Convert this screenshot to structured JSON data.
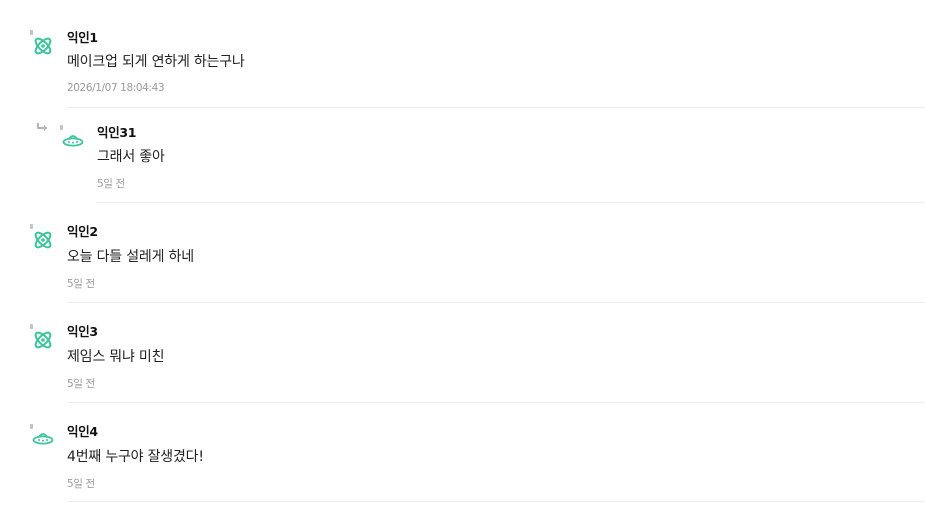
{
  "comments": [
    {
      "nickname": "익인1",
      "text": "메이크업 되게 연하게 하는구나",
      "time": "2026/1/07 18:04:43",
      "avatar_icon": "atom-icon",
      "is_reply": false
    },
    {
      "nickname": "익인31",
      "text": "그래서 좋아",
      "time": "5일 전",
      "avatar_icon": "ufo-icon",
      "is_reply": true
    },
    {
      "nickname": "익인2",
      "text": "오늘 다들 설레게 하네",
      "time": "5일 전",
      "avatar_icon": "atom-icon",
      "is_reply": false
    },
    {
      "nickname": "익인3",
      "text": "제임스 뭐냐 미친",
      "time": "5일 전",
      "avatar_icon": "atom-icon",
      "is_reply": false
    },
    {
      "nickname": "익인4",
      "text": "4번째 누구야 잘생겼다!",
      "time": "5일 전",
      "avatar_icon": "ufo-icon",
      "is_reply": false
    }
  ],
  "colors": {
    "avatar_green": "#3cc49a",
    "nickname": "#111111",
    "text": "#222222",
    "meta": "#9a9a9a",
    "divider": "#ececec",
    "reply_arrow": "#b5b5b5"
  }
}
